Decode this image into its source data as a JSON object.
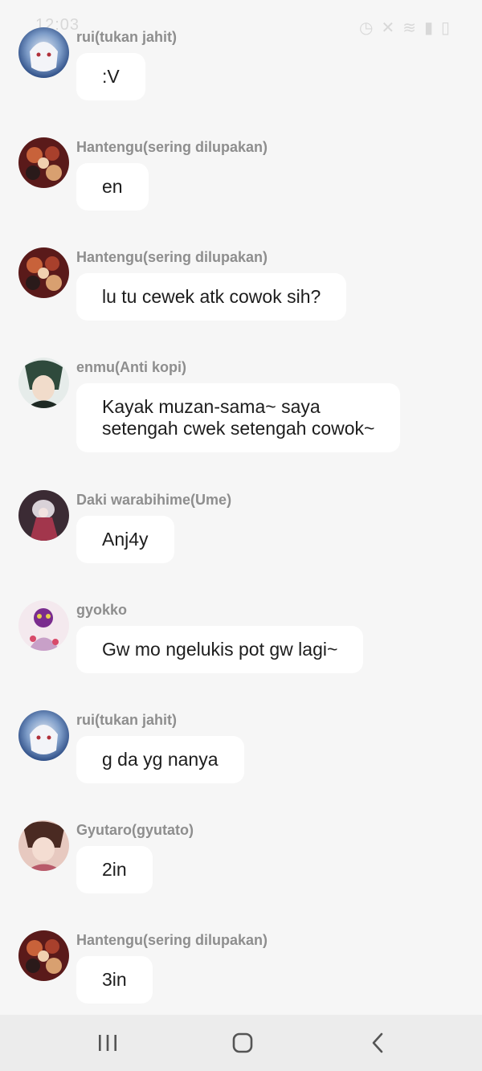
{
  "status_bar": {
    "time": "12:03",
    "icons": [
      "image-icon",
      "whatsapp-icon",
      "alarm-icon",
      "mute-icon",
      "wifi-icon",
      "signal-icon",
      "battery-icon"
    ]
  },
  "messages": [
    {
      "sender": "rui(tukan jahit)",
      "text": ":V",
      "avatar": "rui"
    },
    {
      "sender": "Hantengu(sering dilupakan)",
      "text": "en",
      "avatar": "hantengu"
    },
    {
      "sender": "Hantengu(sering dilupakan)",
      "text": "lu tu cewek atk cowok sih?",
      "avatar": "hantengu"
    },
    {
      "sender": "enmu(Anti kopi)",
      "text": "Kayak muzan-sama~ saya\nsetengah cwek setengah cowok~",
      "avatar": "enmu"
    },
    {
      "sender": "Daki warabihime(Ume)",
      "text": "Anj4y",
      "avatar": "daki"
    },
    {
      "sender": "gyokko",
      "text": "Gw mo ngelukis pot gw lagi~",
      "avatar": "gyokko"
    },
    {
      "sender": "rui(tukan jahit)",
      "text": "g da yg nanya",
      "avatar": "rui"
    },
    {
      "sender": "Gyutaro(gyutato)",
      "text": "2in",
      "avatar": "gyutaro"
    },
    {
      "sender": "Hantengu(sering dilupakan)",
      "text": "3in",
      "avatar": "hantengu"
    }
  ],
  "nav_bar": {
    "buttons": [
      "recent-apps-icon",
      "home-icon",
      "back-icon"
    ]
  },
  "colors": {
    "background": "#f6f6f6",
    "bubble": "#ffffff",
    "sender_text": "#8e8e8e",
    "message_text": "#1d1d1d",
    "nav_bar": "#ececec"
  }
}
